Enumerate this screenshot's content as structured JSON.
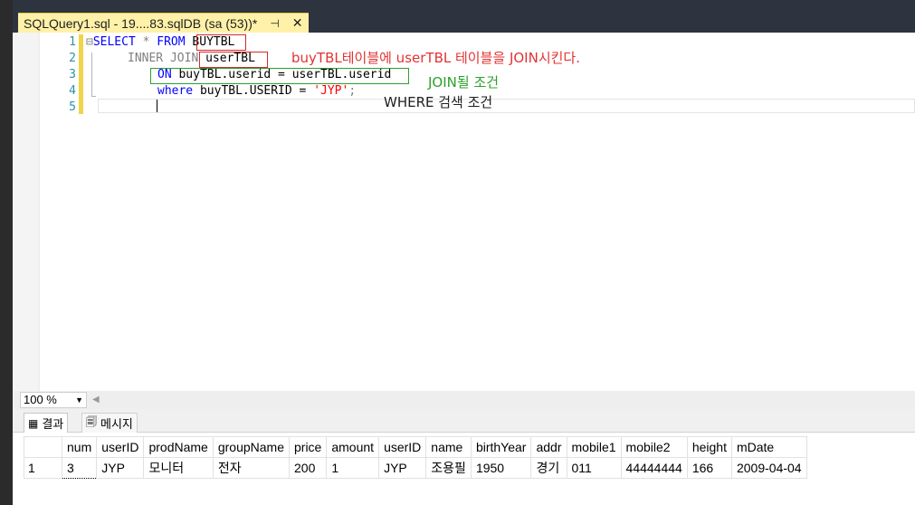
{
  "tab": {
    "title": "SQLQuery1.sql - 19....83.sqlDB (sa (53))*",
    "pin_icon": "⊣",
    "close_icon": "✕"
  },
  "editor": {
    "line_numbers": [
      "1",
      "2",
      "3",
      "4",
      "5"
    ],
    "lines": [
      {
        "fold": "⊟",
        "kw1": "SELECT",
        "mid": " * ",
        "kw2": "FROM",
        "rest": " BUYTBL"
      },
      {
        "pre": "INNER JOIN",
        "rest": " userTBL"
      },
      {
        "kw": "ON",
        "rest": " buyTBL.userid = userTBL.userid"
      },
      {
        "kw": "where",
        "rest": " buyTBL.USERID = ",
        "str": "'JYP'",
        "end": ";"
      }
    ]
  },
  "annotations": {
    "join_note": "buyTBL테이블에 userTBL 테이블을 JOIN시킨다.",
    "join_condition": "JOIN될 조건",
    "where_condition": "WHERE 검색 조건",
    "colors": {
      "red": "#e23333",
      "green": "#2ca02c",
      "black": "#1e1e1e"
    }
  },
  "zoom": {
    "value": "100 %"
  },
  "results": {
    "tabs": {
      "results": "결과",
      "messages": "메시지"
    },
    "columns": [
      "num",
      "userID",
      "prodName",
      "groupName",
      "price",
      "amount",
      "userID",
      "name",
      "birthYear",
      "addr",
      "mobile1",
      "mobile2",
      "height",
      "mDate"
    ],
    "rows": [
      {
        "row": "1",
        "cells": [
          "3",
          "JYP",
          "모니터",
          "전자",
          "200",
          "1",
          "JYP",
          "조용필",
          "1950",
          "경기",
          "011",
          "44444444",
          "166",
          "2009-04-04"
        ]
      }
    ]
  }
}
